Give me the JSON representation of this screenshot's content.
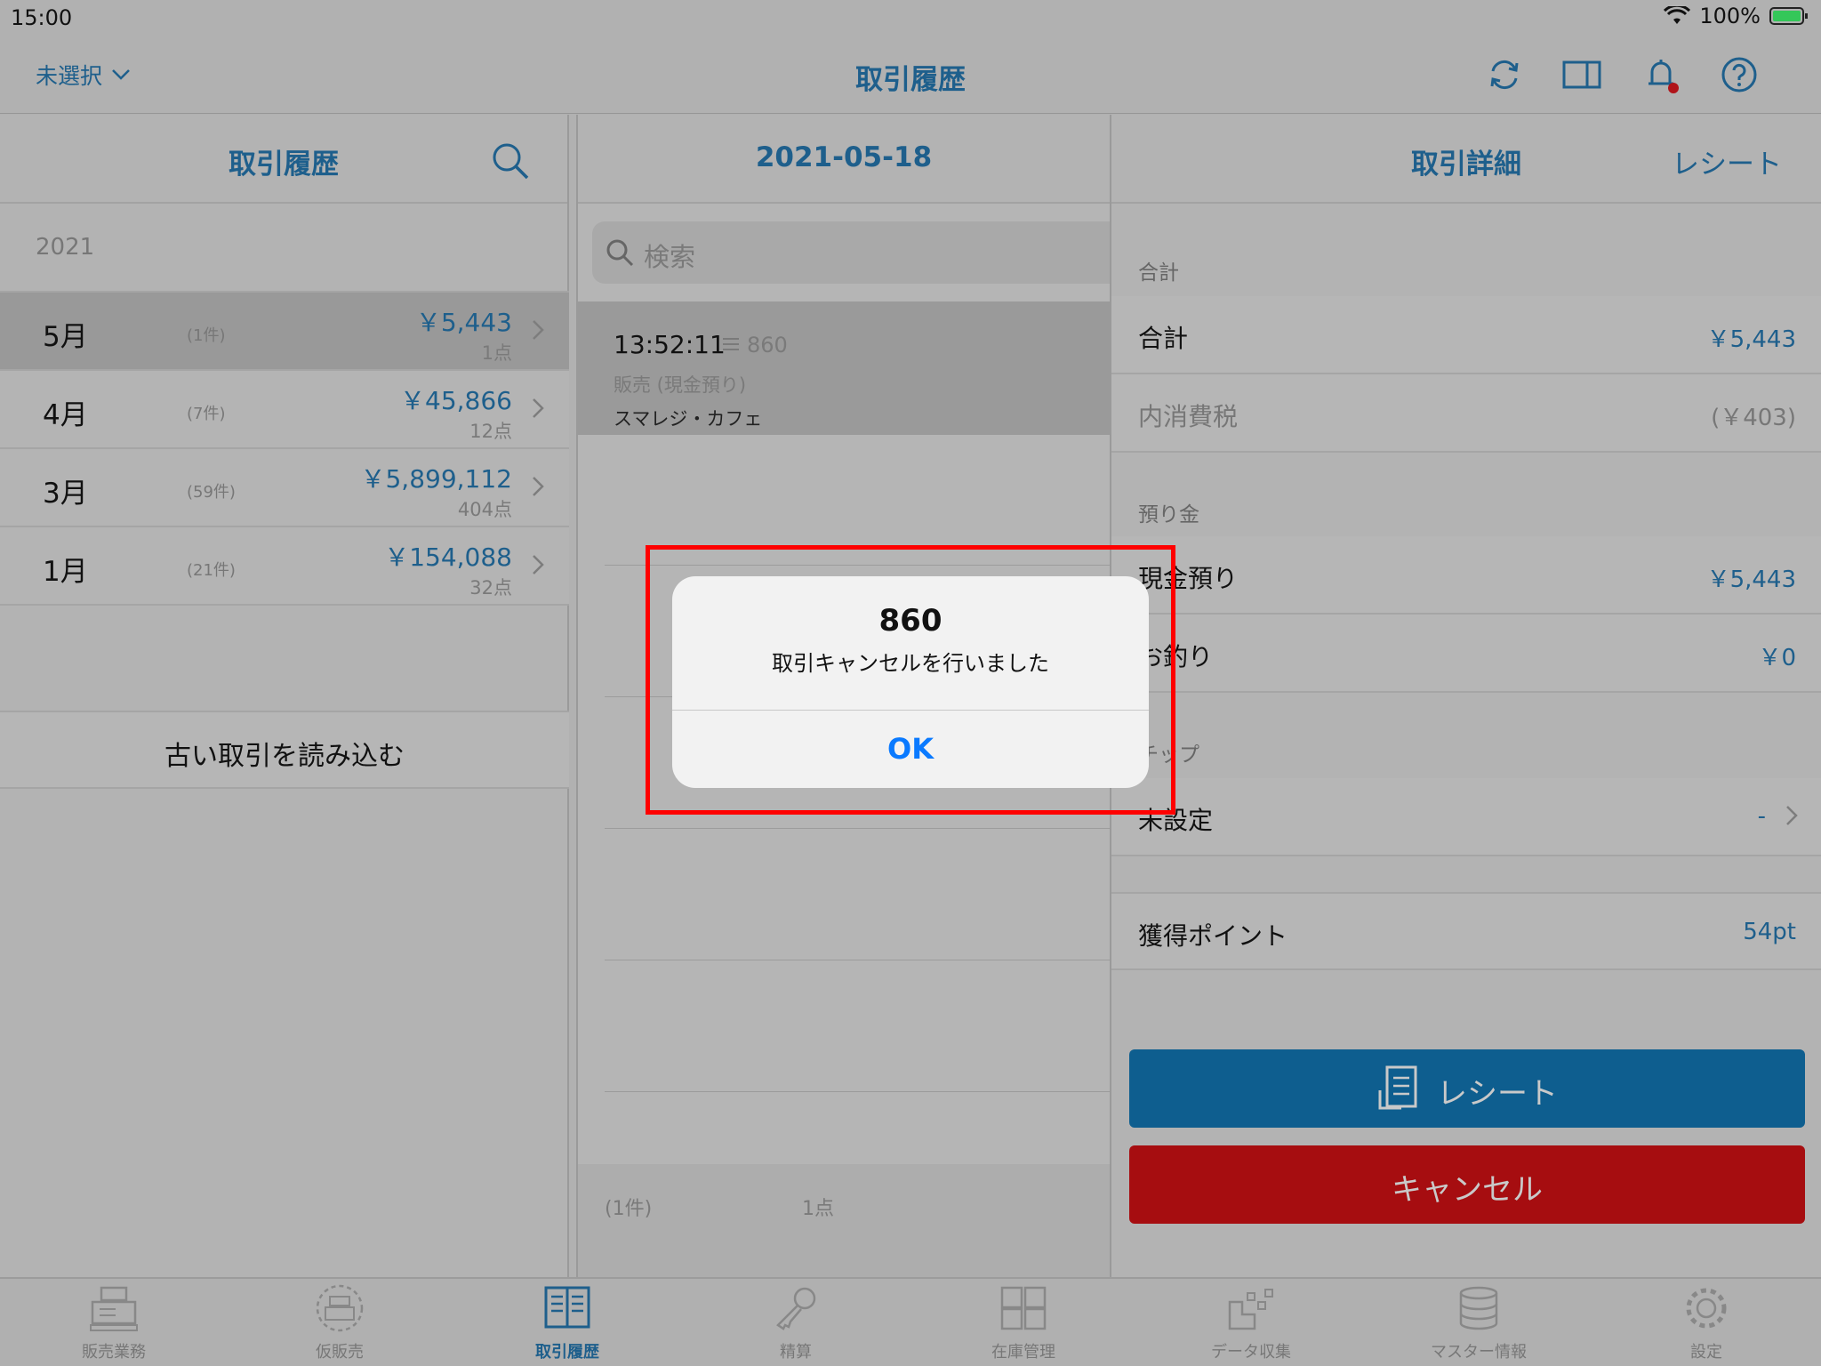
{
  "status": {
    "time": "15:00",
    "battery": "100%"
  },
  "nav": {
    "store_selector": "未選択",
    "title": "取引履歴"
  },
  "history_panel": {
    "title": "取引履歴",
    "year": "2021",
    "months": [
      {
        "label": "5月",
        "count": "(1件)",
        "amount": "￥5,443",
        "points": "1点",
        "selected": true
      },
      {
        "label": "4月",
        "count": "(7件)",
        "amount": "￥45,866",
        "points": "12点",
        "selected": false
      },
      {
        "label": "3月",
        "count": "(59件)",
        "amount": "￥5,899,112",
        "points": "404点",
        "selected": false
      },
      {
        "label": "1月",
        "count": "(21件)",
        "amount": "￥154,088",
        "points": "32点",
        "selected": false
      }
    ],
    "load_older": "古い取引を読み込む"
  },
  "day_panel": {
    "date": "2021-05-18",
    "search_placeholder": "検索",
    "transaction": {
      "time": "13:52:11",
      "id": "860",
      "type": "販売 (現金預り)",
      "store": "スマレジ・カフェ"
    },
    "footer_count": "(1件)",
    "footer_points": "1点"
  },
  "detail_panel": {
    "title": "取引詳細",
    "receipt_link": "レシート",
    "total_header": "合計",
    "total_label": "合計",
    "total_value": "￥5,443",
    "tax_label": "内消費税",
    "tax_value": "(￥403)",
    "deposit_header": "預り金",
    "cash_label": "現金預り",
    "cash_value": "￥5,443",
    "change_label": "お釣り",
    "change_value": "￥0",
    "tip_header": "チップ",
    "tip_label": "未設定",
    "tip_value": "-",
    "points_label": "獲得ポイント",
    "points_value": "54pt",
    "receipt_button": "レシート",
    "cancel_button": "キャンセル",
    "colors": {
      "receipt_button": "#0e5e8f",
      "cancel_button": "#a60d10"
    }
  },
  "dialog": {
    "title": "860",
    "message": "取引キャンセルを行いました",
    "ok": "OK"
  },
  "tabs": [
    {
      "label": "販売業務",
      "icon": "register-icon"
    },
    {
      "label": "仮販売",
      "icon": "temp-sale-icon"
    },
    {
      "label": "取引履歴",
      "icon": "history-book-icon",
      "active": true
    },
    {
      "label": "精算",
      "icon": "key-icon"
    },
    {
      "label": "在庫管理",
      "icon": "inventory-icon"
    },
    {
      "label": "データ収集",
      "icon": "data-collect-icon"
    },
    {
      "label": "マスター情報",
      "icon": "database-icon"
    },
    {
      "label": "設定",
      "icon": "gear-icon"
    }
  ]
}
